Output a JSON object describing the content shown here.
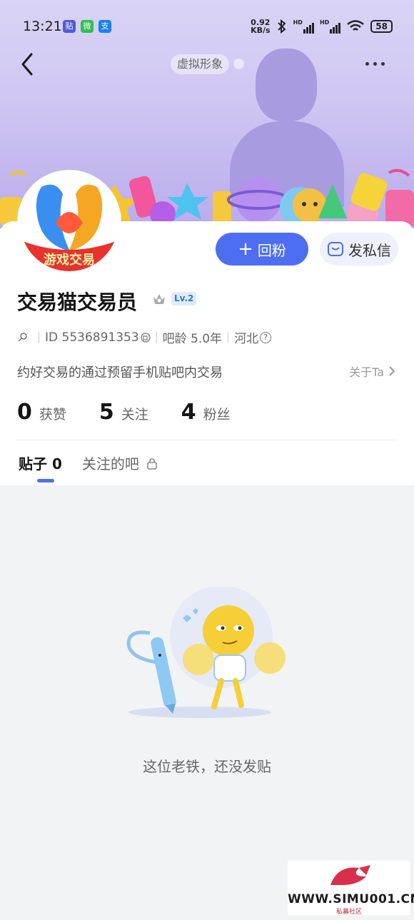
{
  "status_bar": {
    "time": "13:21",
    "app_badges": [
      "贴",
      "微",
      "支"
    ],
    "net_speed_value": "0.92",
    "net_speed_unit": "KB/s",
    "battery": "58",
    "signal_label_1": "HD",
    "signal_label_2": "HD"
  },
  "header": {
    "virtual_avatar_label": "虚拟形象"
  },
  "avatar": {
    "text": "游戏交易"
  },
  "actions": {
    "follow_back_label": "回粉",
    "message_label": "发私信"
  },
  "profile": {
    "username": "交易猫交易员",
    "level": "Lv.2",
    "id_text": "ID 5536891353",
    "bar_age": "吧龄 5.0年",
    "location": "河北",
    "bio": "约好交易的通过预留手机贴吧内交易",
    "about_label": "关于Ta"
  },
  "stats": [
    {
      "value": "0",
      "label": "获赞"
    },
    {
      "value": "5",
      "label": "关注"
    },
    {
      "value": "4",
      "label": "粉丝"
    }
  ],
  "tabs": {
    "posts": "贴子 0",
    "followed_bars": "关注的吧"
  },
  "empty_state": {
    "message": "这位老铁，还没发贴"
  },
  "watermark": {
    "site": "WWW.SIMU001.CN",
    "sub": "私募社区"
  },
  "colors": {
    "accent": "#4e6ef2",
    "banner": "#cfc6f2"
  }
}
